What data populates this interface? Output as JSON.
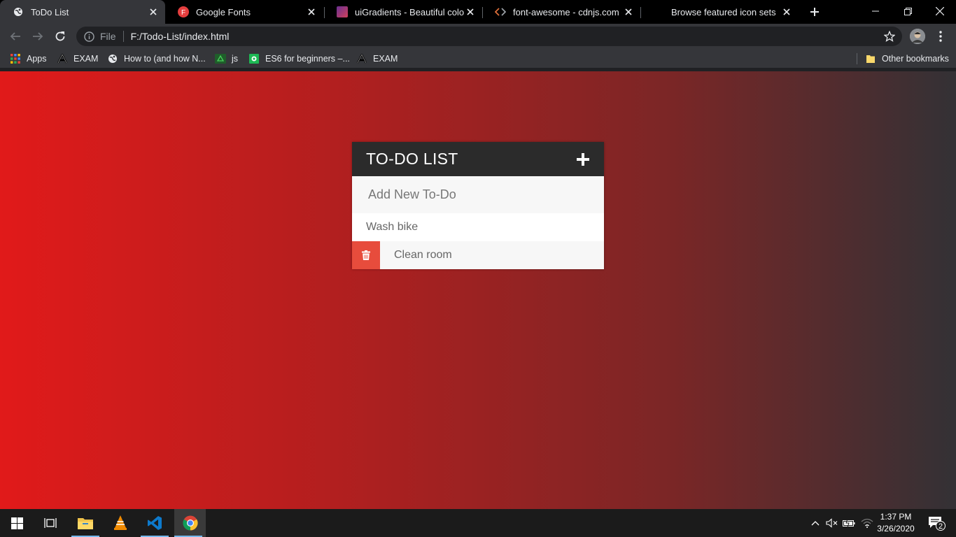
{
  "browser": {
    "tabs": [
      {
        "title": "ToDo List",
        "icon": "globe-icon"
      },
      {
        "title": "Google Fonts",
        "icon": "google-fonts-icon",
        "icon_letter": "F"
      },
      {
        "title": "uiGradients - Beautiful colored",
        "icon": "uigradients-icon"
      },
      {
        "title": "font-awesome - cdnjs.com - Th",
        "icon": "code-icon"
      },
      {
        "title": "Browse featured icon sets",
        "icon": ""
      }
    ],
    "address_bar": {
      "scheme_label": "File",
      "url": "F:/Todo-List/index.html"
    },
    "bookmarks": [
      {
        "label": "Apps",
        "icon": "apps-grid-icon"
      },
      {
        "label": "EXAM",
        "icon": "letter-a-icon"
      },
      {
        "label": "How to (and how N...",
        "icon": "globe-icon"
      },
      {
        "label": "js",
        "icon": "js-icon"
      },
      {
        "label": "ES6 for beginners –...",
        "icon": "es6-icon"
      },
      {
        "label": "EXAM",
        "icon": "letter-a-icon"
      }
    ],
    "other_bookmarks": "Other bookmarks"
  },
  "app": {
    "title": "TO-DO LIST",
    "input_placeholder": "Add New To-Do",
    "items": [
      {
        "text": "Wash bike"
      },
      {
        "text": "Clean room"
      }
    ],
    "colors": {
      "header": "#2b2b2b",
      "delete": "#e74c3c",
      "gradient_start": "#e11a1a",
      "gradient_end": "#333135"
    }
  },
  "taskbar": {
    "time": "1:37 PM",
    "date": "3/26/2020",
    "notification_count": "2"
  }
}
